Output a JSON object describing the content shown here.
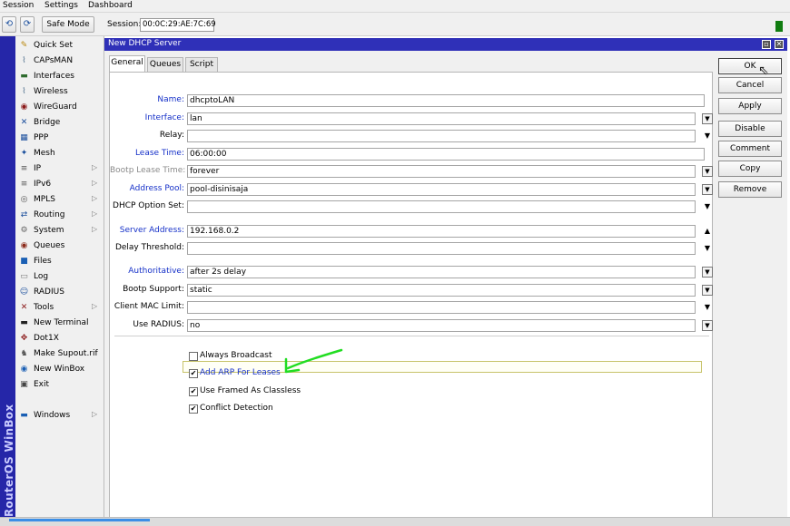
{
  "menu": [
    "Session",
    "Settings",
    "Dashboard"
  ],
  "toolbar": {
    "undo_icon": "undo-icon",
    "redo_icon": "redo-icon",
    "safe_mode": "Safe Mode",
    "session_label": "Session:",
    "session_value": "00:0C:29:AE:7C:69",
    "status_color": "#107c10"
  },
  "brand": "RouterOS WinBox",
  "sidebar": [
    {
      "label": "Quick Set",
      "icon": "quick-set-icon",
      "glyph": "✎",
      "color": "#b8860b",
      "arrow": false
    },
    {
      "label": "CAPsMAN",
      "icon": "capsman-icon",
      "glyph": "⌇",
      "color": "#4a6b8a",
      "arrow": false
    },
    {
      "label": "Interfaces",
      "icon": "interfaces-icon",
      "glyph": "▬",
      "color": "#2e6b2e",
      "arrow": false
    },
    {
      "label": "Wireless",
      "icon": "wireless-icon",
      "glyph": "⌇",
      "color": "#4a6b8a",
      "arrow": false
    },
    {
      "label": "WireGuard",
      "icon": "wireguard-icon",
      "glyph": "◉",
      "color": "#8b1a1a",
      "arrow": false
    },
    {
      "label": "Bridge",
      "icon": "bridge-icon",
      "glyph": "✕",
      "color": "#1a4e9c",
      "arrow": false
    },
    {
      "label": "PPP",
      "icon": "ppp-icon",
      "glyph": "▦",
      "color": "#1a4e9c",
      "arrow": false
    },
    {
      "label": "Mesh",
      "icon": "mesh-icon",
      "glyph": "✦",
      "color": "#1a4e9c",
      "arrow": false
    },
    {
      "label": "IP",
      "icon": "ip-icon",
      "glyph": "≡",
      "color": "#555555",
      "arrow": true
    },
    {
      "label": "IPv6",
      "icon": "ipv6-icon",
      "glyph": "≡",
      "color": "#555555",
      "arrow": true
    },
    {
      "label": "MPLS",
      "icon": "mpls-icon",
      "glyph": "◎",
      "color": "#555555",
      "arrow": true
    },
    {
      "label": "Routing",
      "icon": "routing-icon",
      "glyph": "⇄",
      "color": "#1a4e9c",
      "arrow": true
    },
    {
      "label": "System",
      "icon": "system-icon",
      "glyph": "⚙",
      "color": "#666666",
      "arrow": true
    },
    {
      "label": "Queues",
      "icon": "queues-icon",
      "glyph": "◉",
      "color": "#8b2a1a",
      "arrow": false
    },
    {
      "label": "Files",
      "icon": "files-icon",
      "glyph": "■",
      "color": "#1a5fb4",
      "arrow": false
    },
    {
      "label": "Log",
      "icon": "log-icon",
      "glyph": "▭",
      "color": "#777777",
      "arrow": false
    },
    {
      "label": "RADIUS",
      "icon": "radius-icon",
      "glyph": "☺",
      "color": "#1a4e9c",
      "arrow": false
    },
    {
      "label": "Tools",
      "icon": "tools-icon",
      "glyph": "✕",
      "color": "#8b1a1a",
      "arrow": true
    },
    {
      "label": "New Terminal",
      "icon": "terminal-icon",
      "glyph": "▬",
      "color": "#222222",
      "arrow": false
    },
    {
      "label": "Dot1X",
      "icon": "dot1x-icon",
      "glyph": "✥",
      "color": "#8b1a1a",
      "arrow": false
    },
    {
      "label": "Make Supout.rif",
      "icon": "supout-icon",
      "glyph": "♞",
      "color": "#555555",
      "arrow": false
    },
    {
      "label": "New WinBox",
      "icon": "new-winbox-icon",
      "glyph": "◉",
      "color": "#1a5fb4",
      "arrow": false
    },
    {
      "label": "Exit",
      "icon": "exit-icon",
      "glyph": "▣",
      "color": "#444444",
      "arrow": false
    },
    {
      "label": "Windows",
      "icon": "windows-icon",
      "glyph": "▬",
      "color": "#1a5fb4",
      "arrow": true
    }
  ],
  "window": {
    "title": "New DHCP Server",
    "restore_icon": "restore-icon",
    "close_icon": "close-icon"
  },
  "tabs": [
    "General",
    "Queues",
    "Script"
  ],
  "fields": [
    {
      "label": "Name:",
      "value": "dhcptoLAN",
      "style": "blue",
      "control": "none"
    },
    {
      "label": "Interface:",
      "value": "lan",
      "style": "blue",
      "control": "dropdown"
    },
    {
      "label": "Relay:",
      "value": "",
      "style": "black",
      "control": "arrow-down"
    },
    {
      "label": "Lease Time:",
      "value": "06:00:00",
      "style": "blue",
      "control": "none"
    },
    {
      "label": "Bootp Lease Time:",
      "value": "forever",
      "style": "grey",
      "control": "dropdown"
    },
    {
      "label": "Address Pool:",
      "value": "pool-disinisaja",
      "style": "blue",
      "control": "dropdown"
    },
    {
      "label": "DHCP Option Set:",
      "value": "",
      "style": "black",
      "control": "arrow-down"
    },
    {
      "label": "Server Address:",
      "value": "192.168.0.2",
      "style": "blue",
      "control": "arrow-up"
    },
    {
      "label": "Delay Threshold:",
      "value": "",
      "style": "black",
      "control": "arrow-down"
    },
    {
      "label": "Authoritative:",
      "value": "after 2s delay",
      "style": "blue",
      "control": "dropdown"
    },
    {
      "label": "Bootp Support:",
      "value": "static",
      "style": "black",
      "control": "dropdown"
    },
    {
      "label": "Client MAC Limit:",
      "value": "",
      "style": "black",
      "control": "arrow-down"
    },
    {
      "label": "Use RADIUS:",
      "value": "no",
      "style": "black",
      "control": "dropdown"
    }
  ],
  "checkboxes": [
    {
      "label": "Always Broadcast",
      "checked": false
    },
    {
      "label": "Add ARP For Leases",
      "checked": true
    },
    {
      "label": "Use Framed As Classless",
      "checked": true
    },
    {
      "label": "Conflict Detection",
      "checked": true
    }
  ],
  "buttons": [
    "OK",
    "Cancel",
    "Apply",
    "Disable",
    "Comment",
    "Copy",
    "Remove"
  ],
  "colors": {
    "title_bar": "#2f30b8",
    "brand_strip": "#2526a8",
    "annotation": "#22dd22",
    "label_blue": "#1530c8"
  }
}
